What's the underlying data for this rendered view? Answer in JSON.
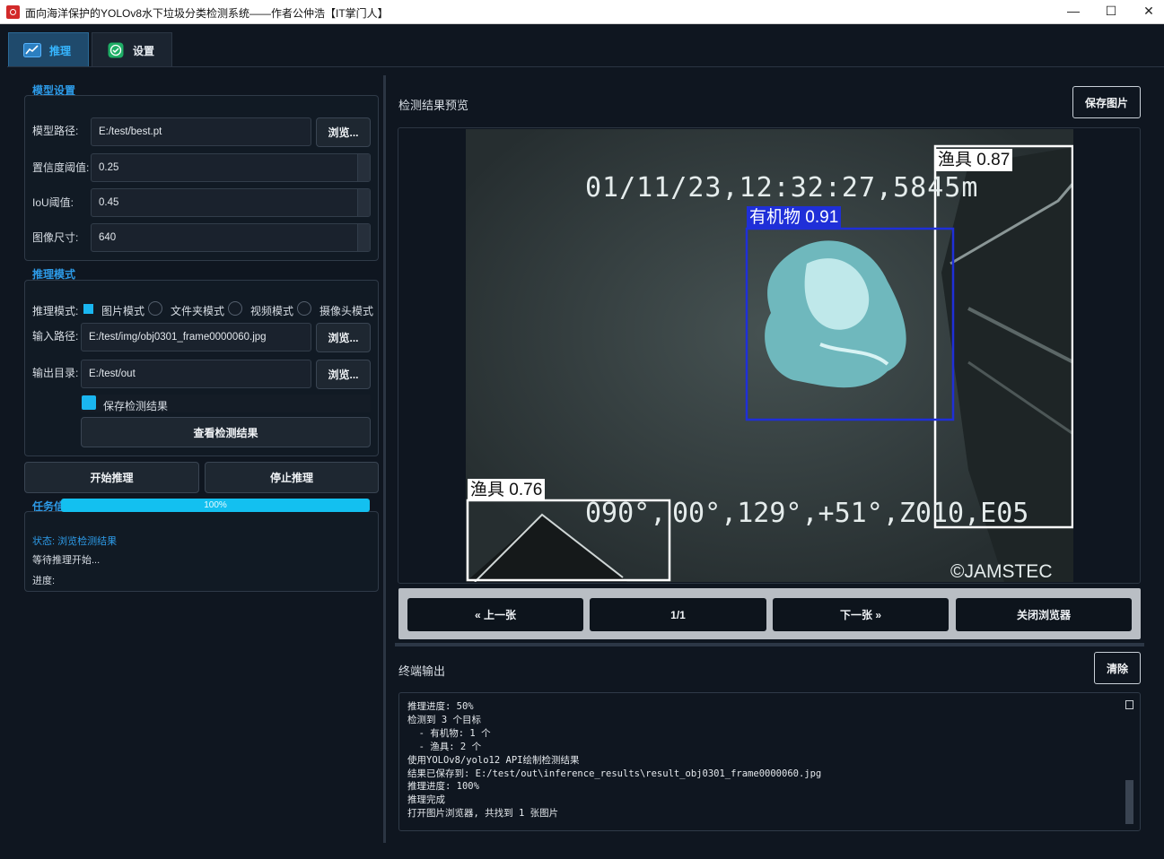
{
  "window": {
    "title": "面向海洋保护的YOLOv8水下垃圾分类检测系统——作者公仲浩【IT掌门人】",
    "minimize": "—",
    "maximize": "☐",
    "close": "✕"
  },
  "tabs": [
    {
      "label": "推理",
      "icon": "chart-line-icon",
      "active": true
    },
    {
      "label": "设置",
      "icon": "check-icon",
      "active": false
    }
  ],
  "model_settings": {
    "title": "模型设置",
    "model_path_label": "模型路径:",
    "model_path": "E:/test/best.pt",
    "browse": "浏览...",
    "confidence_label": "置信度阈值:",
    "confidence": "0.25",
    "iou_label": "IoU阈值:",
    "iou": "0.45",
    "imgsize_label": "图像尺寸:",
    "imgsize": "640"
  },
  "inference_mode": {
    "title": "推理模式",
    "mode_label": "推理模式:",
    "modes": [
      "图片模式",
      "文件夹模式",
      "视频模式",
      "摄像头模式"
    ],
    "selected": "图片模式",
    "input_label": "输入路径:",
    "input_path": "E:/test/img/obj0301_frame0000060.jpg",
    "output_label": "输出目录:",
    "output_path": "E:/test/out",
    "browse": "浏览...",
    "save_results": "保存检测结果",
    "save_checked": true,
    "view_results": "查看检测结果"
  },
  "actions": {
    "start": "开始推理",
    "stop": "停止推理"
  },
  "task_info": {
    "title": "任务信息",
    "status": "状态: 浏览检测结果",
    "waiting": "等待推理开始...",
    "progress_label": "进度:",
    "progress_text": "100%",
    "progress_value": 1.0
  },
  "preview": {
    "title": "检测结果预览",
    "save_image": "保存图片",
    "overlay_timestamp": "01/11/23,12:32:27,5845m",
    "overlay_coords_left": "090°,",
    "overlay_coords_right": "00°,129°,+51°,Z010,E05",
    "overlay_credit": "©JAMSTEC",
    "detections": [
      {
        "label": "渔具 0.87",
        "color": "#ffffff"
      },
      {
        "label": "有机物 0.91",
        "color": "#1f2fd8"
      },
      {
        "label": "渔具 0.76",
        "color": "#ffffff"
      }
    ]
  },
  "navigator": {
    "prev": "« 上一张",
    "counter": "1/1",
    "next": "下一张 »",
    "close": "关闭浏览器"
  },
  "terminal": {
    "title": "终端输出",
    "clear": "清除",
    "lines": [
      "推理进度: 50%",
      "检测到 3 个目标",
      "  - 有机物: 1 个",
      "  - 渔具: 2 个",
      "使用YOLOv8/yolo12 API绘制检测结果",
      "结果已保存到: E:/test/out\\inference_results\\result_obj0301_frame0000060.jpg",
      "推理进度: 100%",
      "推理完成",
      "打开图片浏览器, 共找到 1 张图片"
    ]
  }
}
